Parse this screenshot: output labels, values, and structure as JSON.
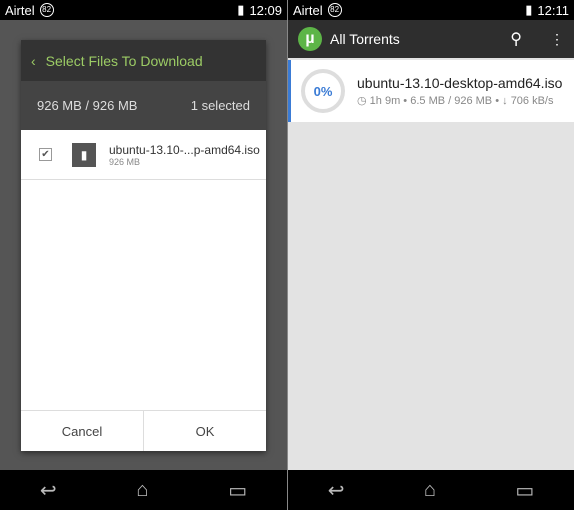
{
  "left": {
    "status": {
      "carrier": "Airtel",
      "badge": "82",
      "time": "12:09"
    },
    "dialog": {
      "title": "Select Files To Download",
      "size": "926 MB / 926 MB",
      "selected": "1 selected",
      "file": {
        "name": "ubuntu-13.10-...p-amd64.iso",
        "size": "926 MB",
        "checked": "✔"
      },
      "cancel": "Cancel",
      "ok": "OK"
    }
  },
  "right": {
    "status": {
      "carrier": "Airtel",
      "badge": "82",
      "time": "12:11"
    },
    "title": "All Torrents",
    "torrent": {
      "progress": "0%",
      "name": "ubuntu-13.10-desktop-amd64.iso",
      "eta": "1h 9m",
      "downloaded": "6.5 MB / 926 MB",
      "speed": "706 kB/s"
    }
  },
  "nav": {
    "back": "↩",
    "home": "⌂",
    "recents": "▭"
  }
}
